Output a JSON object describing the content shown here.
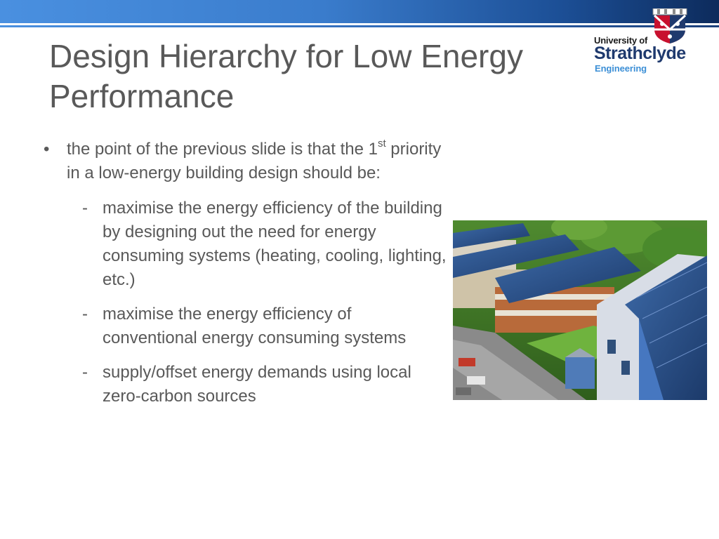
{
  "slide": {
    "title": "Design Hierarchy for Low Energy Performance",
    "logo": {
      "line1": "University of",
      "line2": "Strathclyde",
      "line3": "Engineering"
    },
    "bullet": {
      "mark": "•",
      "text_before": "the point of the previous slide is that the 1",
      "superscript": "st",
      "text_after": " priority in a low-energy building design should be:"
    },
    "sub_items": [
      {
        "mark": "-",
        "text": "maximise the energy efficiency of the building by designing out the need for energy consuming systems (heating, cooling, lighting, etc.)"
      },
      {
        "mark": "-",
        "text": "maximise the energy efficiency of conventional energy consuming systems"
      },
      {
        "mark": "-",
        "text": "supply/offset energy demands using local zero-carbon sources"
      }
    ]
  },
  "colors": {
    "header_blue_light": "#4a90e0",
    "header_blue_dark": "#0d2b5c",
    "body_text": "#595959",
    "logo_navy": "#1f3a6e",
    "logo_blue": "#3c8fd6"
  }
}
